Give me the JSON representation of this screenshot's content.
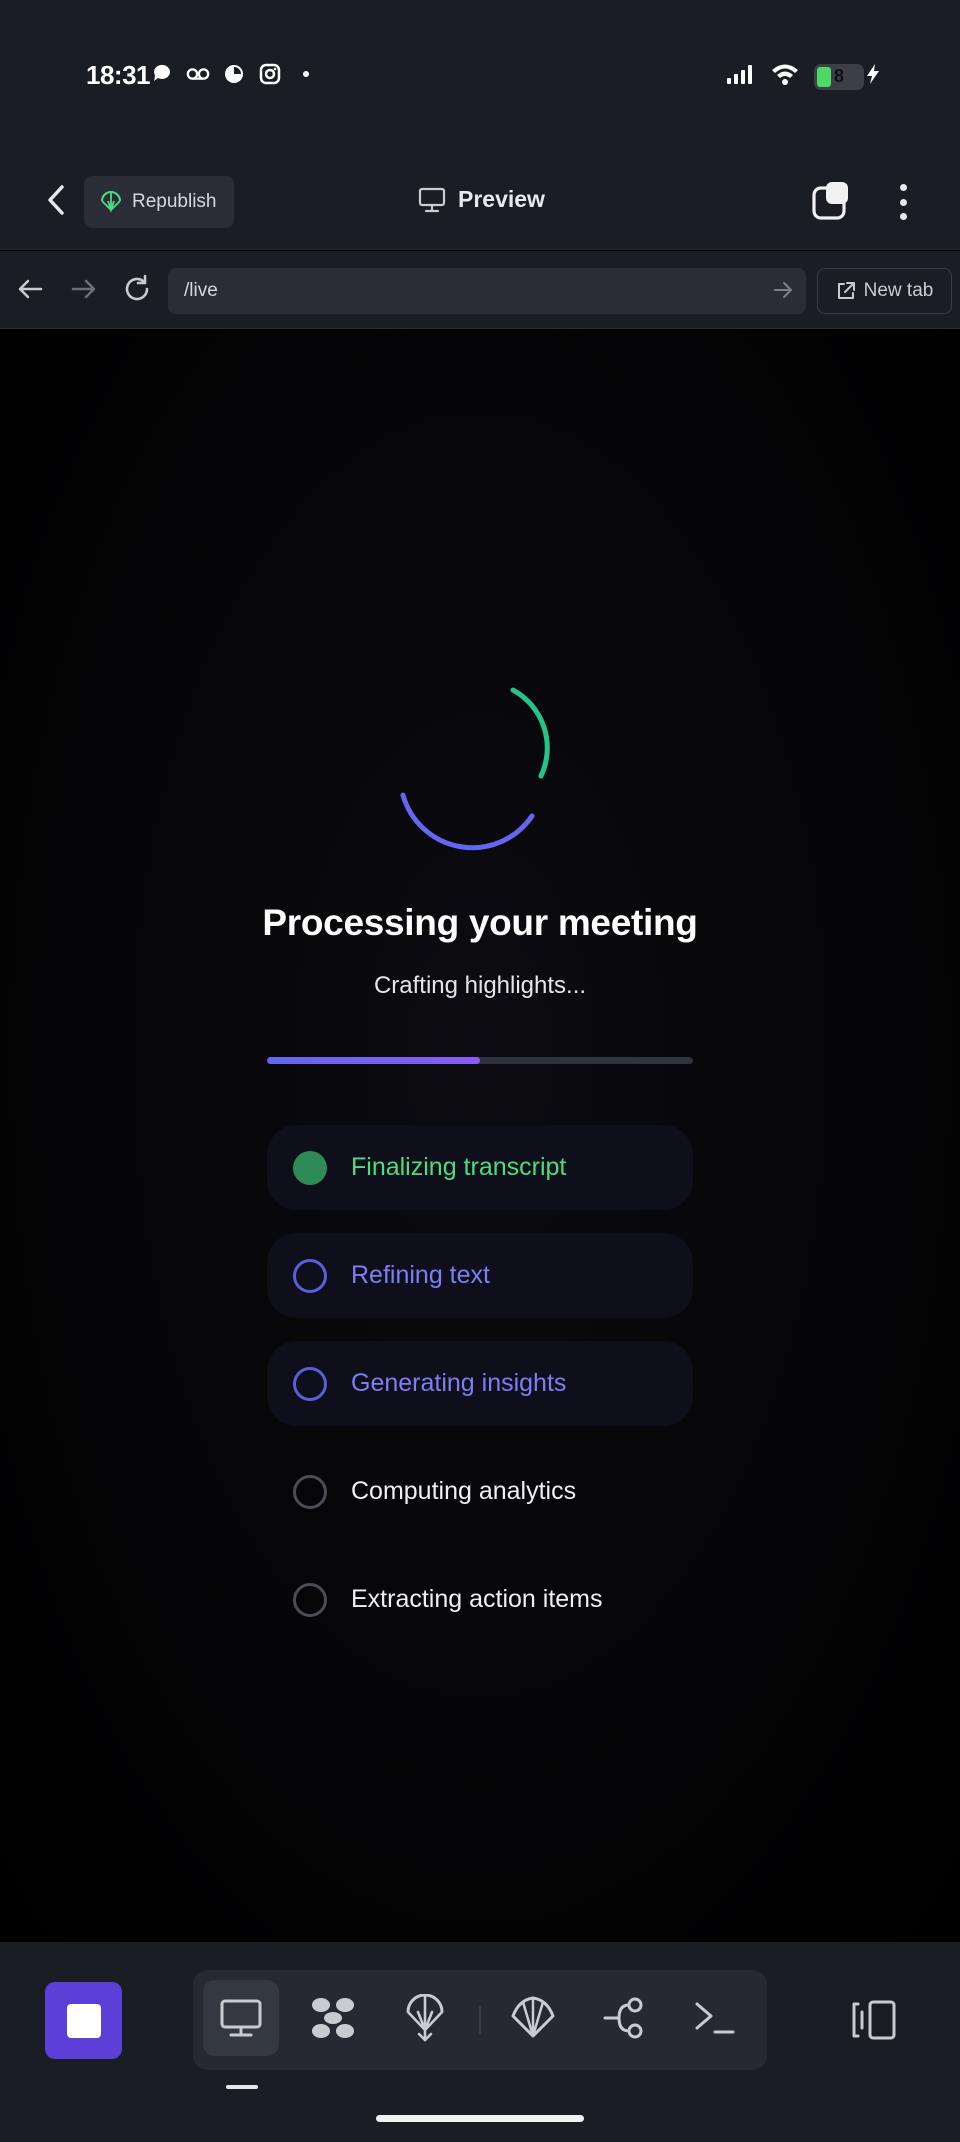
{
  "status": {
    "time": "18:31",
    "icons": [
      "chat-bubble-icon",
      "voicemail-icon",
      "pie-icon",
      "instagram-icon",
      "dot-icon"
    ],
    "battery_level": "8",
    "battery_charging": true
  },
  "header": {
    "republish_label": "Republish",
    "title": "Preview"
  },
  "browser": {
    "url": "/live",
    "new_tab_label": "New tab"
  },
  "processing": {
    "title": "Processing your meeting",
    "subtitle": "Crafting highlights...",
    "progress_percent": 50,
    "steps": [
      {
        "label": "Finalizing transcript",
        "state": "done"
      },
      {
        "label": "Refining text",
        "state": "active"
      },
      {
        "label": "Generating insights",
        "state": "active"
      },
      {
        "label": "Computing analytics",
        "state": "pending"
      },
      {
        "label": "Extracting action items",
        "state": "pending"
      }
    ]
  },
  "colors": {
    "accent": "#6366f1",
    "success": "#4ade80",
    "stop_button": "#5b3fd6",
    "chrome_bg": "#1b1d24"
  },
  "toolbar": {
    "tools": [
      "monitor-icon",
      "puzzle-icon",
      "parachute-icon",
      "shell-icon",
      "branch-icon",
      "terminal-icon"
    ],
    "selected": "monitor-icon"
  }
}
